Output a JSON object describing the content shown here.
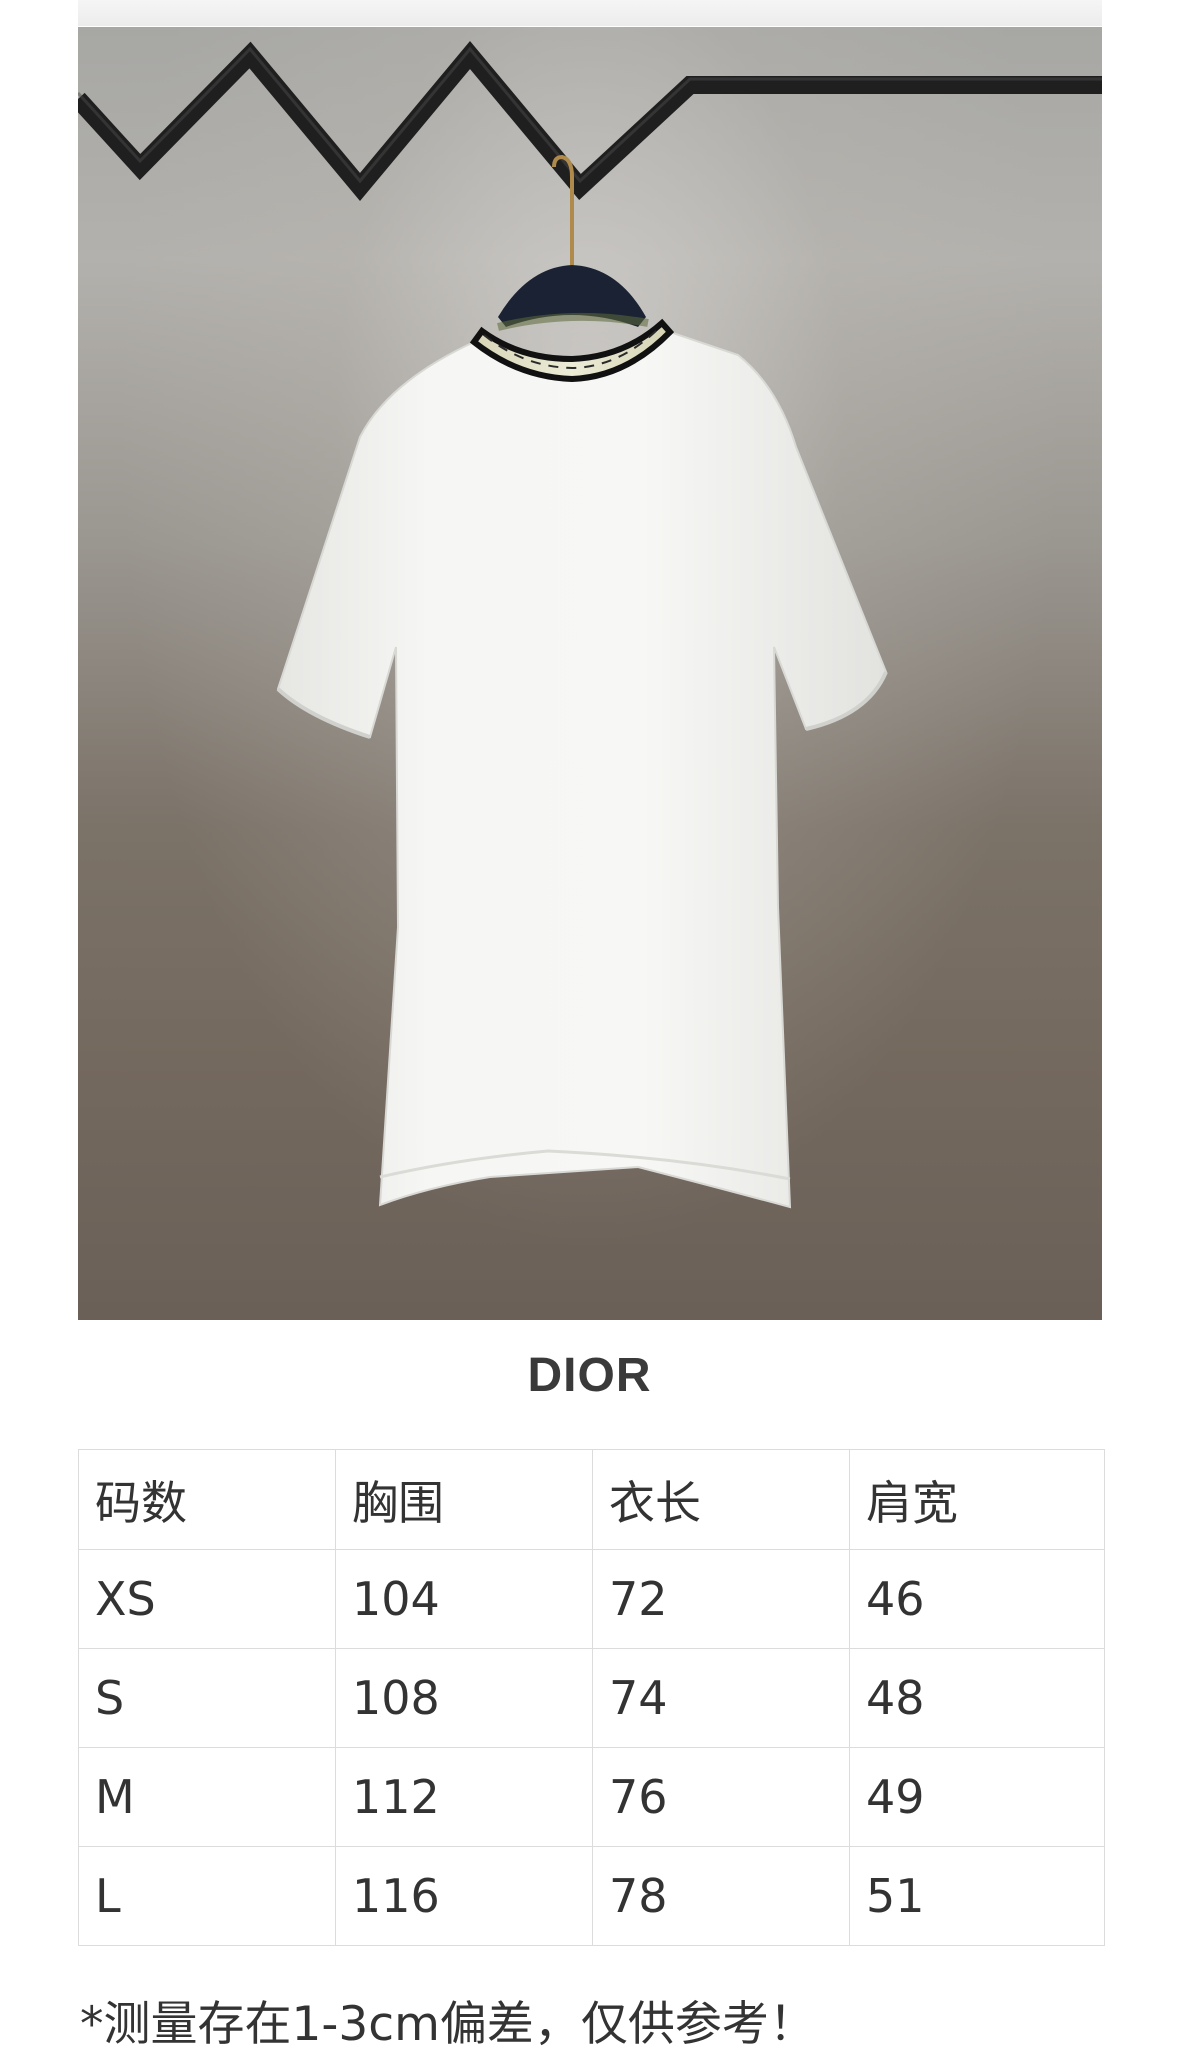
{
  "brand": "DIOR",
  "size_table": {
    "headers": [
      "码数",
      "胸围",
      "衣长",
      "肩宽"
    ],
    "rows": [
      [
        "XS",
        "104",
        "72",
        "46"
      ],
      [
        "S",
        "108",
        "74",
        "48"
      ],
      [
        "M",
        "112",
        "76",
        "49"
      ],
      [
        "L",
        "116",
        "78",
        "51"
      ]
    ]
  },
  "note": "*测量存在1-3cm偏差，仅供参考！",
  "colors": {
    "background": "#ffffff",
    "text": "#333333",
    "table_border": "#dcdcdc",
    "photo_wall_top": "#a7a7a4",
    "photo_wall_bottom": "#6a6058",
    "shirt": "#f4f4f2"
  },
  "photo": {
    "subject": "white-tshirt-on-hanger"
  }
}
